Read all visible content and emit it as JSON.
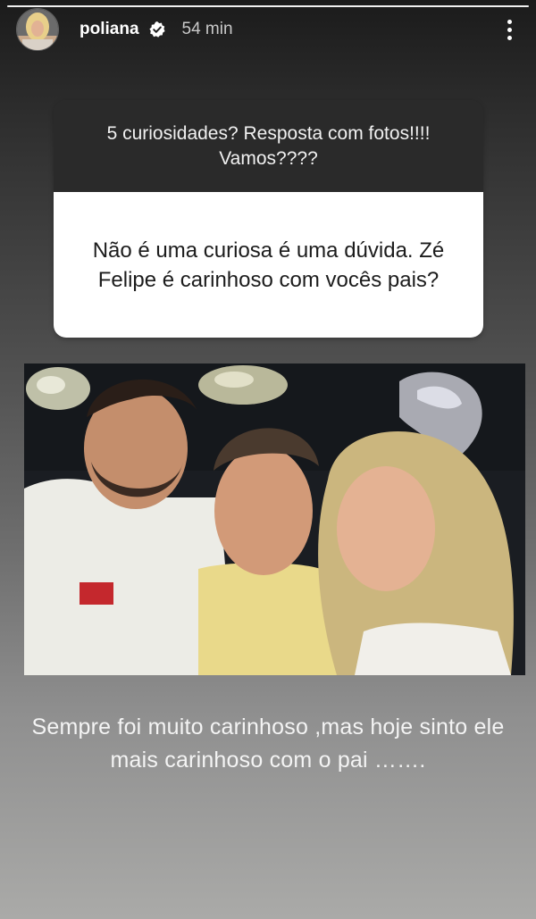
{
  "story": {
    "progress_fraction": 1.0
  },
  "header": {
    "username": "poliana",
    "time": "54 min",
    "avatar_icon": "user-avatar",
    "verified_icon": "verified-badge-icon",
    "more_icon": "more-vertical-icon"
  },
  "question_card": {
    "prompt": "5 curiosidades? Resposta com fotos!!!! Vamos????",
    "question": "Não é uma curiosa é uma dúvida. Zé Felipe é carinhoso com vocês pais?"
  },
  "caption": {
    "text": "Sempre foi muito carinhoso ,mas hoje sinto ele mais carinhoso com o pai ……."
  },
  "colors": {
    "card_top": "#2a2a2a",
    "card_bottom": "#ffffff",
    "text_light": "#ffffff"
  }
}
